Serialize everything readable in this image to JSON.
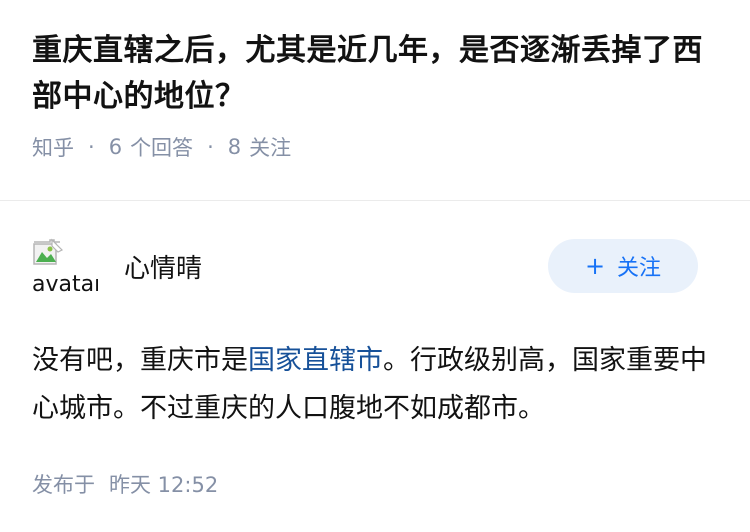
{
  "question": {
    "title": "重庆直辖之后，尤其是近几年，是否逐渐丢掉了西部中心的地位？",
    "source": "知乎",
    "answer_count": "6",
    "answer_label": "个回答",
    "follower_count": "8",
    "follower_label": "关注"
  },
  "answer": {
    "author": {
      "name": "心情晴",
      "avatar_alt": "avatar"
    },
    "follow_button": {
      "plus": "+",
      "label": "关注"
    },
    "content": {
      "before_link": "没有吧，重庆市是",
      "link_text": "国家直辖市",
      "after_link": "。行政级别高，国家重要中心城市。不过重庆的人口腹地不如成都市。"
    },
    "published": {
      "label": "发布于",
      "time": "昨天 12:52"
    }
  },
  "colors": {
    "accent": "#1772f6",
    "link": "#175199",
    "meta": "#8590a6",
    "follow_bg": "#e9f1fb"
  }
}
